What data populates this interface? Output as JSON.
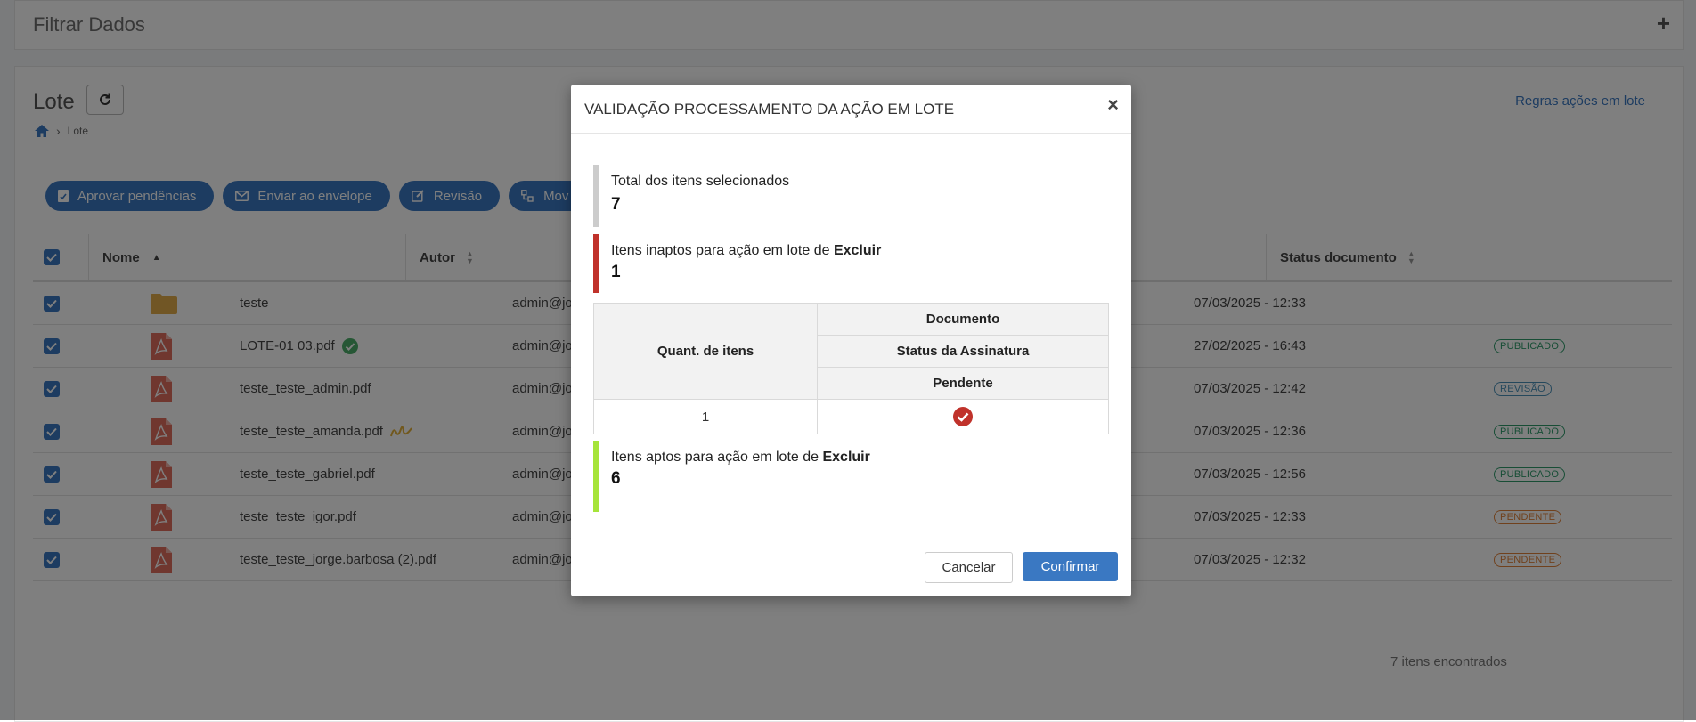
{
  "filter": {
    "title": "Filtrar Dados",
    "expand_symbol": "+"
  },
  "header": {
    "title": "Lote",
    "breadcrumb_current": "Lote",
    "rules_link": "Regras ações em lote"
  },
  "actions": [
    {
      "label": "Aprovar pendências",
      "icon": "file-check-icon"
    },
    {
      "label": "Enviar ao envelope",
      "icon": "envelope-icon"
    },
    {
      "label": "Revisão",
      "icon": "edit-icon"
    },
    {
      "label": "Mov",
      "icon": "move-icon"
    }
  ],
  "table": {
    "columns": {
      "name": "Nome",
      "author": "Autor",
      "status": "Status documento"
    },
    "rows": [
      {
        "type": "folder",
        "name": "teste",
        "author": "admin@jorge",
        "date": "07/03/2025 - 12:33",
        "status": "",
        "status_color": ""
      },
      {
        "type": "pdf",
        "name": "LOTE-01 03.pdf",
        "extra_icon": "verified-check-icon",
        "author": "admin@jorge",
        "date": "27/02/2025 - 16:43",
        "status": "PUBLICADO",
        "status_color": "#2e9b6b"
      },
      {
        "type": "pdf",
        "name": "teste_teste_admin.pdf",
        "author": "admin@jorge",
        "date": "07/03/2025 - 12:42",
        "status": "REVISÃO",
        "status_color": "#4a90b8"
      },
      {
        "type": "pdf",
        "name": "teste_teste_amanda.pdf",
        "extra_icon": "signature-icon",
        "author": "admin@jorge",
        "date": "07/03/2025 - 12:36",
        "status": "PUBLICADO",
        "status_color": "#2e9b6b"
      },
      {
        "type": "pdf",
        "name": "teste_teste_gabriel.pdf",
        "author": "admin@jorge",
        "date": "07/03/2025 - 12:56",
        "status": "PUBLICADO",
        "status_color": "#2e9b6b"
      },
      {
        "type": "pdf",
        "name": "teste_teste_igor.pdf",
        "author": "admin@jorge",
        "date": "07/03/2025 - 12:33",
        "status": "PENDENTE",
        "status_color": "#e0823a"
      },
      {
        "type": "pdf",
        "name": "teste_teste_jorge.barbosa (2).pdf",
        "author": "admin@jorge",
        "date": "07/03/2025 - 12:32",
        "status": "PENDENTE",
        "status_color": "#e0823a"
      }
    ],
    "found_text": "7 itens encontrados"
  },
  "modal": {
    "title": "VALIDAÇÃO PROCESSAMENTO DA AÇÃO EM LOTE",
    "close": "×",
    "total_label": "Total dos itens selecionados",
    "total_value": "7",
    "inapt_label": "Itens inaptos para ação em lote de ",
    "inapt_action": "Excluir",
    "inapt_value": "1",
    "table": {
      "qty_header": "Quant. de itens",
      "doc_header": "Documento",
      "sig_header": "Status da Assinatura",
      "pending_header": "Pendente",
      "qty_value": "1",
      "pending_icon": "check-circle-icon"
    },
    "apt_label": "Itens aptos para ação em lote de ",
    "apt_action": "Excluir",
    "apt_value": "6",
    "cancel": "Cancelar",
    "confirm": "Confirmar",
    "colors": {
      "total_bar": "#cccccc",
      "inapt_bar": "#c0322b",
      "apt_bar": "#a6e43a",
      "primary": "#3a78c2"
    }
  }
}
